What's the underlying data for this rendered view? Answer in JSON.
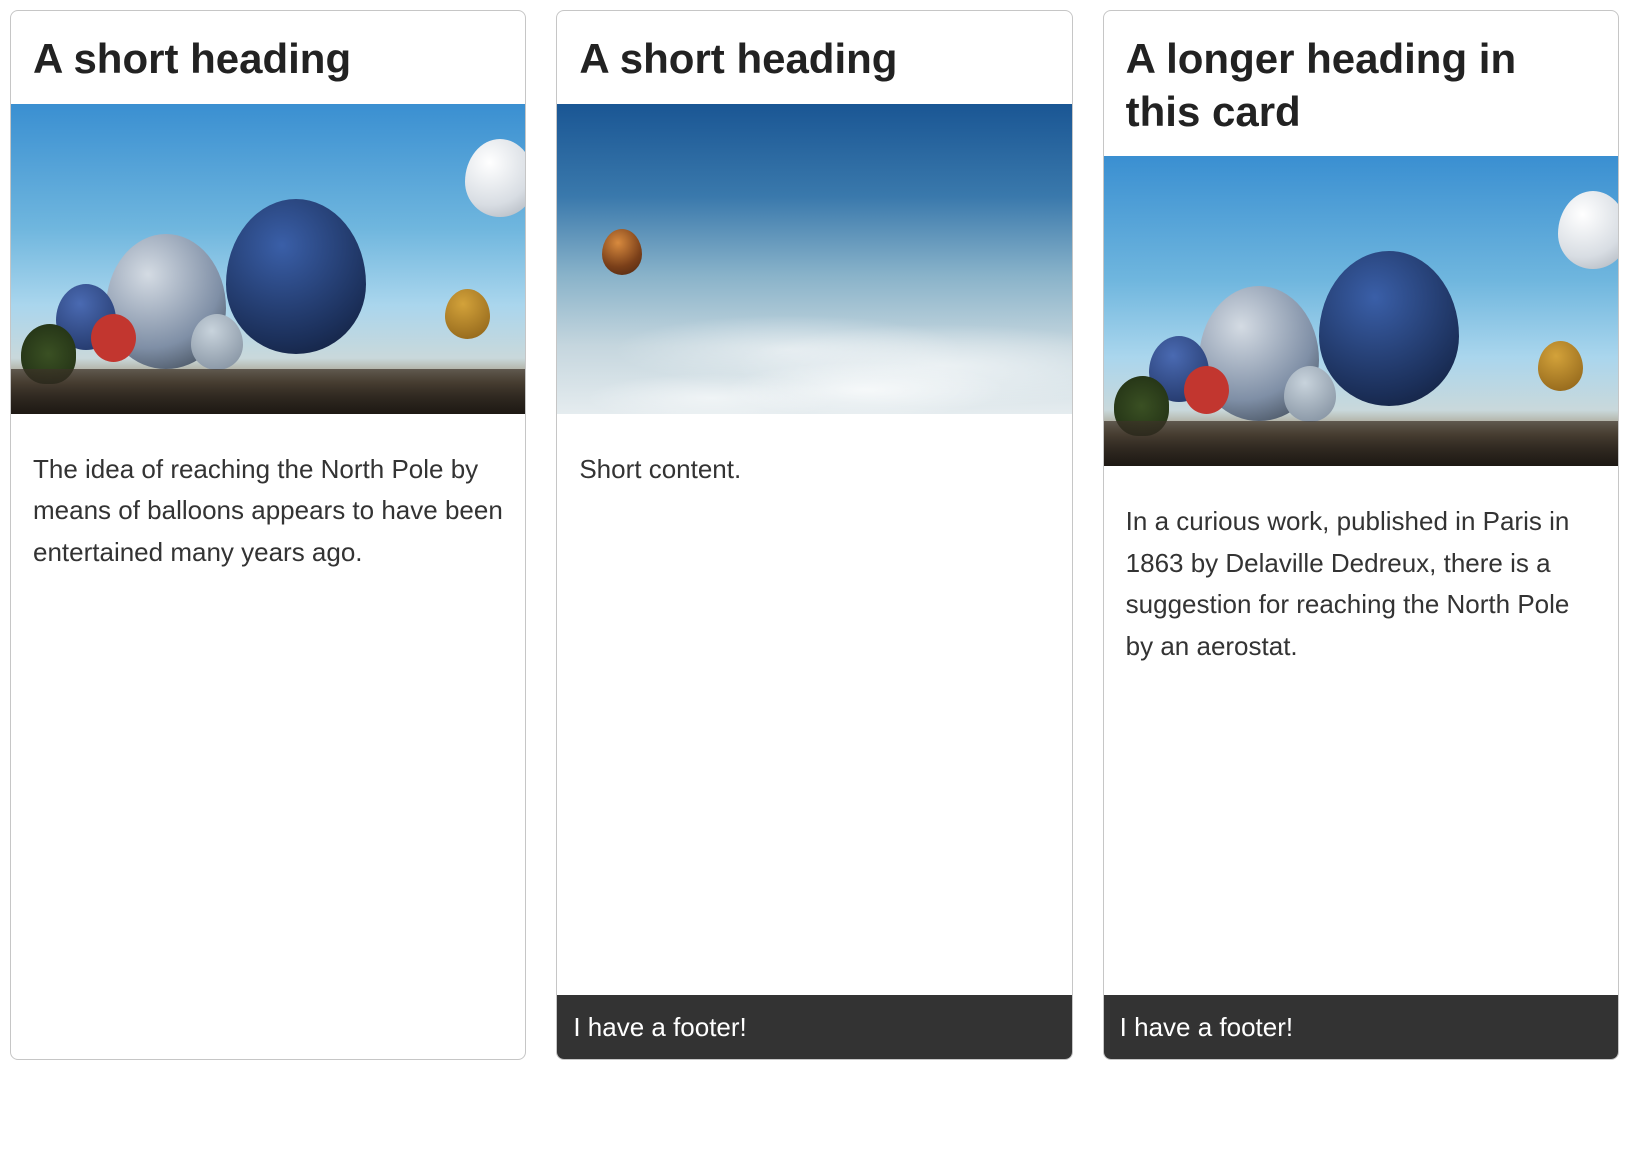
{
  "cards": [
    {
      "heading": "A short heading",
      "content": "The idea of reaching the North Pole by means of balloons appears to have been entertained many years ago.",
      "footer": null,
      "image_style": "festival"
    },
    {
      "heading": "A short heading",
      "content": "Short content.",
      "footer": "I have a footer!",
      "image_style": "sky"
    },
    {
      "heading": "A longer heading in this card",
      "content": "In a curious work, published in Paris in 1863 by Delaville Dedreux, there is a suggestion for reaching the North Pole by an aerostat.",
      "footer": "I have a footer!",
      "image_style": "festival"
    }
  ]
}
